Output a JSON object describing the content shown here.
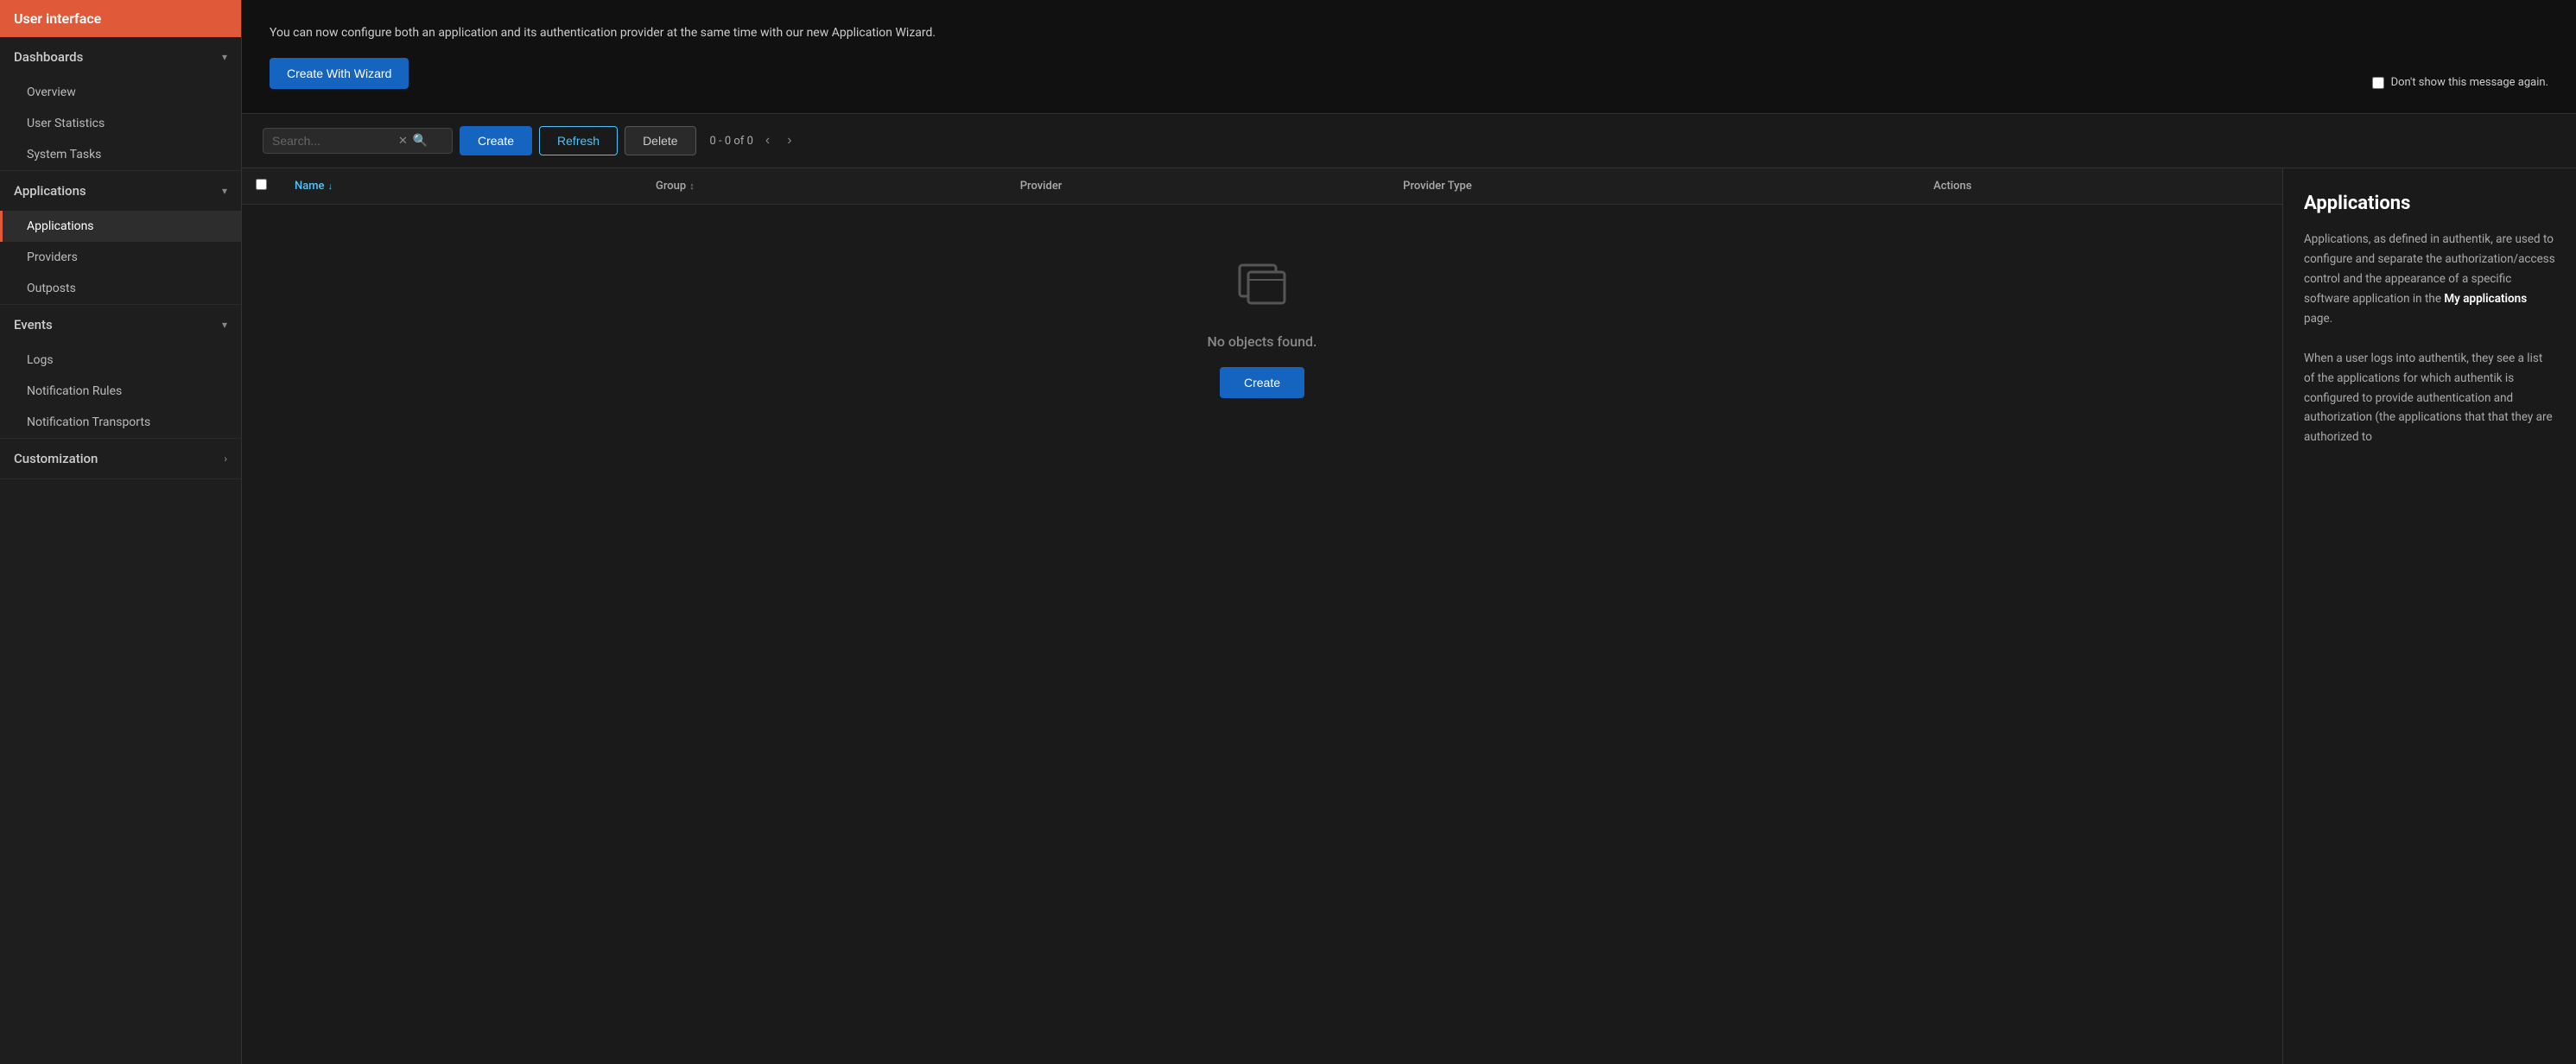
{
  "sidebar": {
    "header": "User interface",
    "sections": [
      {
        "id": "dashboards",
        "label": "Dashboards",
        "expanded": true,
        "items": [
          {
            "id": "overview",
            "label": "Overview",
            "active": false
          },
          {
            "id": "user-statistics",
            "label": "User Statistics",
            "active": false
          },
          {
            "id": "system-tasks",
            "label": "System Tasks",
            "active": false
          }
        ]
      },
      {
        "id": "applications",
        "label": "Applications",
        "expanded": true,
        "items": [
          {
            "id": "applications",
            "label": "Applications",
            "active": true
          },
          {
            "id": "providers",
            "label": "Providers",
            "active": false
          },
          {
            "id": "outposts",
            "label": "Outposts",
            "active": false
          }
        ]
      },
      {
        "id": "events",
        "label": "Events",
        "expanded": true,
        "items": [
          {
            "id": "logs",
            "label": "Logs",
            "active": false
          },
          {
            "id": "notification-rules",
            "label": "Notification Rules",
            "active": false
          },
          {
            "id": "notification-transports",
            "label": "Notification Transports",
            "active": false
          }
        ]
      },
      {
        "id": "customization",
        "label": "Customization",
        "expanded": false,
        "items": []
      }
    ]
  },
  "banner": {
    "text": "You can now configure both an application and its authentication provider at the same time with our new Application Wizard.",
    "create_button": "Create With Wizard",
    "dont_show_label": "Don't show this message again."
  },
  "toolbar": {
    "search_placeholder": "Search...",
    "create_label": "Create",
    "refresh_label": "Refresh",
    "delete_label": "Delete",
    "pagination_text": "0 - 0 of 0"
  },
  "table": {
    "columns": [
      {
        "id": "name",
        "label": "Name",
        "sortable": true,
        "sort_active": true
      },
      {
        "id": "group",
        "label": "Group",
        "sortable": true,
        "sort_active": false
      },
      {
        "id": "provider",
        "label": "Provider",
        "sortable": false
      },
      {
        "id": "provider-type",
        "label": "Provider Type",
        "sortable": false
      },
      {
        "id": "actions",
        "label": "Actions",
        "sortable": false
      }
    ],
    "empty_text": "No objects found.",
    "empty_create_label": "Create"
  },
  "right_panel": {
    "title": "Applications",
    "paragraphs": [
      "Applications, as defined in authentik, are used to configure and separate the authorization/access control and the appearance of a specific software application in the My applications page.",
      "When a user logs into authentik, they see a list of the applications for which authentik is configured to provide authentication and authorization (the applications that that they are authorized to"
    ],
    "bold_text": "My applications"
  },
  "icons": {
    "chevron_down": "▾",
    "chevron_right": "›",
    "sort_asc": "↓",
    "sort_both": "↕",
    "search": "🔍",
    "clear": "✕",
    "prev": "‹",
    "next": "›"
  }
}
